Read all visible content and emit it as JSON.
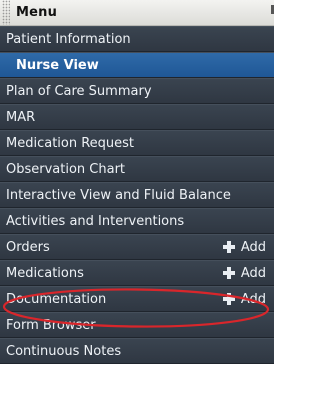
{
  "header": {
    "title": "Menu"
  },
  "items": [
    {
      "label": "Patient Information"
    },
    {
      "label": "Nurse View",
      "active": true
    },
    {
      "label": "Plan of Care Summary"
    },
    {
      "label": "MAR"
    },
    {
      "label": "Medication Request"
    },
    {
      "label": "Observation Chart"
    },
    {
      "label": "Interactive View and Fluid Balance"
    },
    {
      "label": "Activities and Interventions"
    },
    {
      "label": "Orders",
      "add_label": "Add"
    },
    {
      "label": "Medications",
      "add_label": "Add"
    },
    {
      "label": "Documentation",
      "add_label": "Add"
    },
    {
      "label": "Form Browser"
    },
    {
      "label": "Continuous Notes"
    }
  ],
  "colors": {
    "item_bg": "#333c47",
    "active_bg": "#245f9f",
    "highlight": "#d9262b"
  }
}
